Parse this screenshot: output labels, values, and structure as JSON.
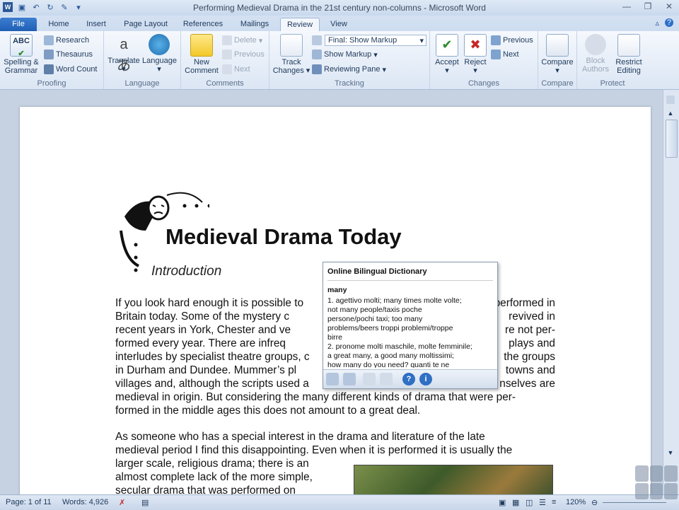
{
  "window": {
    "title": "Performing Medieval Drama in the 21st century non-columns  -  Microsoft Word"
  },
  "tabs": [
    "File",
    "Home",
    "Insert",
    "Page Layout",
    "References",
    "Mailings",
    "Review",
    "View"
  ],
  "ribbon": {
    "proofing": {
      "spelling": "Spelling &",
      "grammar": "Grammar",
      "research": "Research",
      "thesaurus": "Thesaurus",
      "word_count": "Word Count",
      "label": "Proofing"
    },
    "language": {
      "translate": "Translate",
      "language": "Language",
      "label": "Language"
    },
    "comments": {
      "new1": "New",
      "new2": "Comment",
      "delete": "Delete",
      "previous": "Previous",
      "next": "Next",
      "label": "Comments"
    },
    "tracking": {
      "track1": "Track",
      "track2": "Changes",
      "display_select": "Final: Show Markup",
      "show_markup": "Show Markup",
      "reviewing_pane": "Reviewing Pane",
      "label": "Tracking"
    },
    "changes": {
      "accept": "Accept",
      "reject": "Reject",
      "previous": "Previous",
      "next": "Next",
      "label": "Changes"
    },
    "compare": {
      "compare": "Compare",
      "label": "Compare"
    },
    "protect": {
      "block1": "Block",
      "block2": "Authors",
      "restrict1": "Restrict",
      "restrict2": "Editing",
      "label": "Protect"
    }
  },
  "document": {
    "heading": "Medieval Drama Today",
    "subheading": "Introduction",
    "paragraph1_lines": [
      "If you look hard enough it is possible to",
      "performed in",
      "Britain today.  Some of the mystery c",
      "revived in",
      "recent years in York, Chester and ve",
      "re not per-",
      "formed every year.   There are infreq",
      "plays and",
      "interludes by specialist theatre groups, c",
      "the groups",
      "in Durham and Dundee.  Mummer’s pl",
      "towns and",
      "villages and, although the scripts used a",
      "nselves are",
      "medieval in origin.  But considering the many different kinds of drama that were per-",
      "formed in the middle ages this does not amount to a great deal."
    ],
    "paragraph2_lines": [
      "As someone who has a special interest in the drama and literature of the late",
      "medieval period I find this disappointing.  Even when it is performed it is usually the",
      "larger scale, religious drama; there is an",
      "almost complete lack of the more simple,",
      "secular drama that was performed on"
    ]
  },
  "dictionary_popup": {
    "title": "Online Bilingual Dictionary",
    "headword": "many",
    "lines": [
      "1. agettivo molti; many times molte volte;",
      " not many people/taxis poche",
      "persone/pochi taxi;  too many",
      "problems/beers troppi problemi/troppe",
      "birre",
      "2. pronome molti maschile, molte femminile;",
      " a great many, a good many moltissimi;",
      " how many do you need? quanti te ne"
    ]
  },
  "status": {
    "page": "Page: 1 of 11",
    "words": "Words: 4,926",
    "zoom": "120%"
  },
  "colors": {
    "file_tab": "#1f5fb5",
    "ribbon_bg": "#dbe6f4",
    "page_bg": "#ffffff"
  }
}
